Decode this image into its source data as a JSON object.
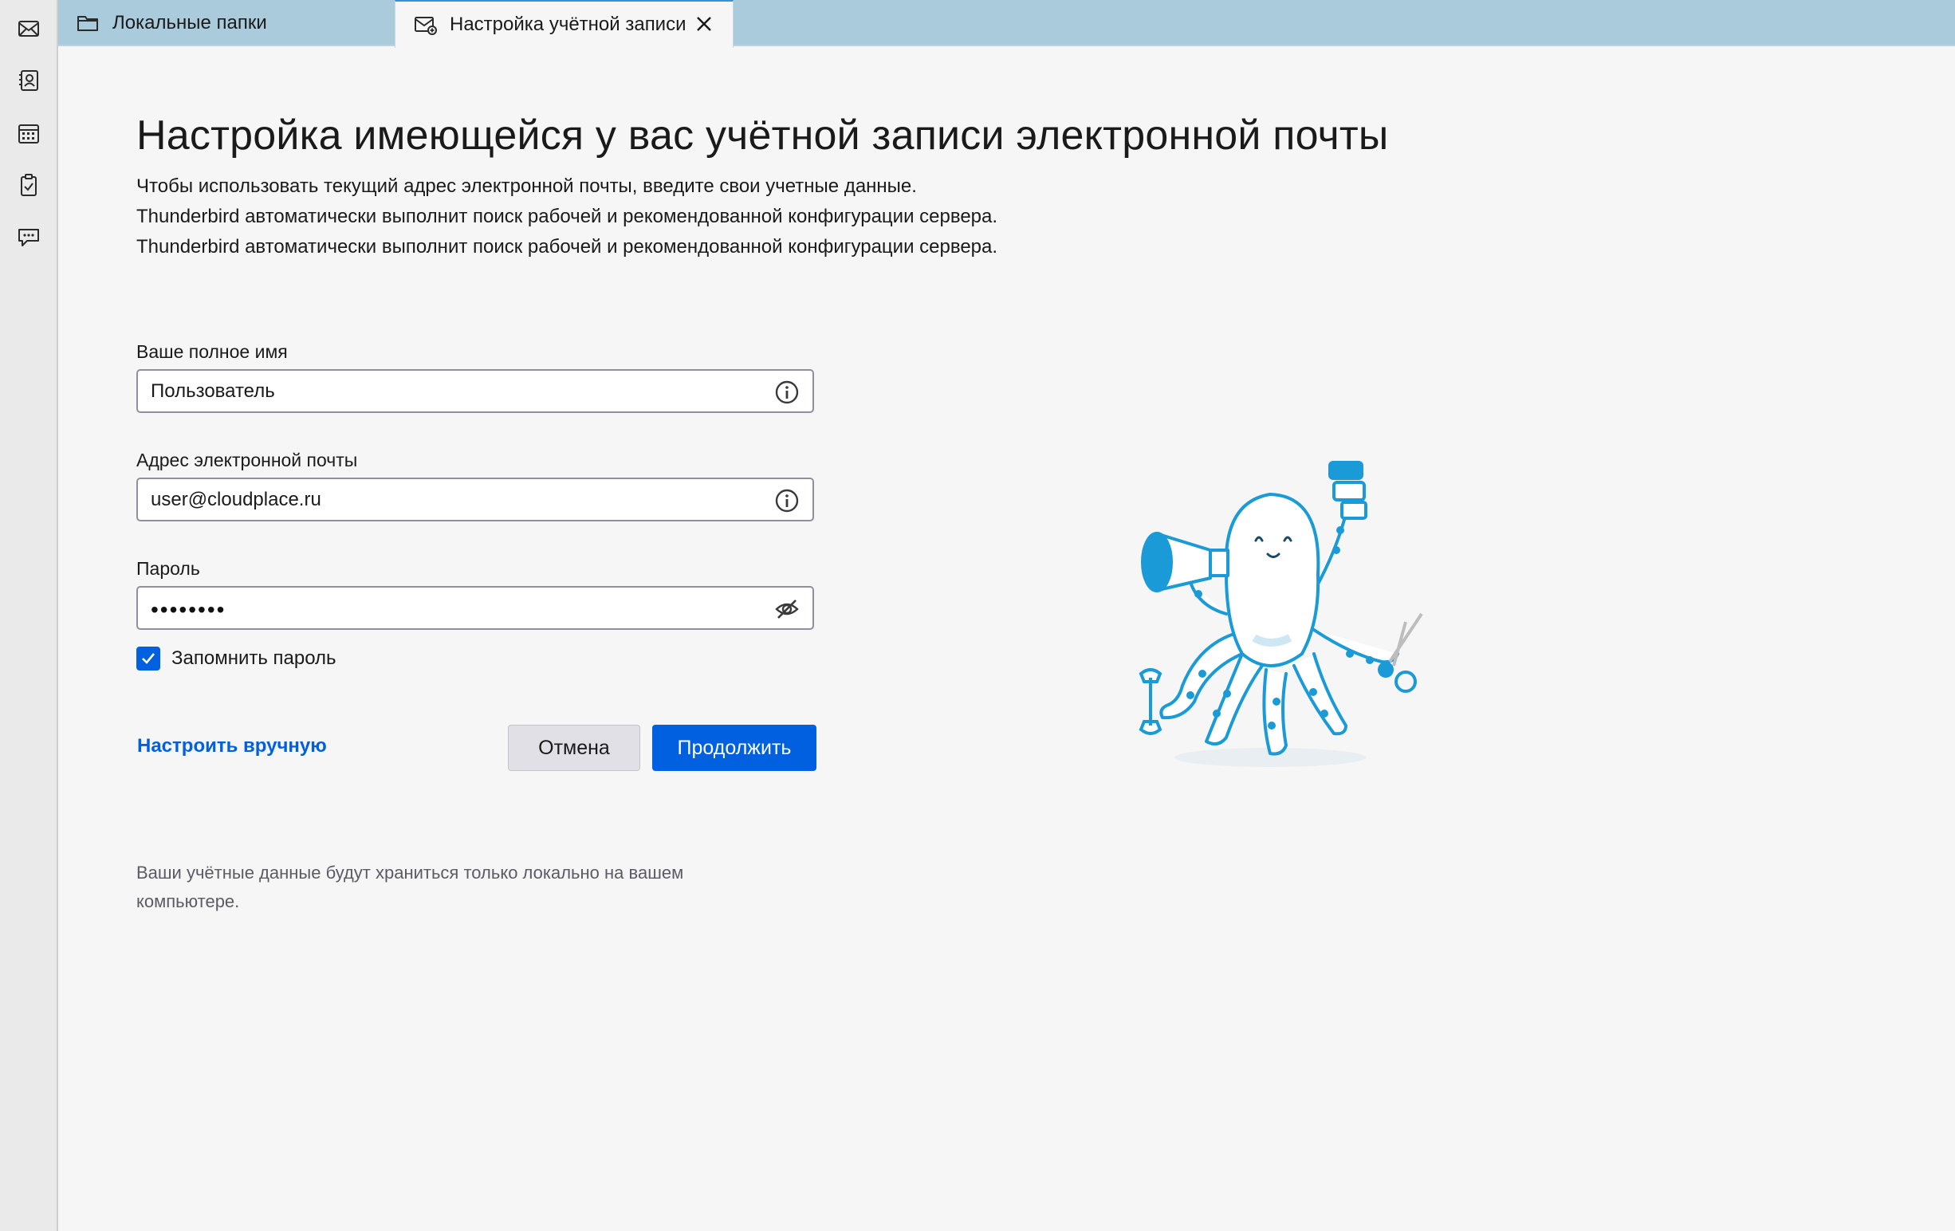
{
  "spaces": [
    {
      "name": "mail",
      "icon": "envelope-icon"
    },
    {
      "name": "address-book",
      "icon": "contacts-icon"
    },
    {
      "name": "calendar",
      "icon": "calendar-icon"
    },
    {
      "name": "tasks",
      "icon": "tasks-icon"
    },
    {
      "name": "chat",
      "icon": "chat-icon"
    }
  ],
  "tabs": [
    {
      "label": "Локальные папки",
      "icon": "folder-icon",
      "active": false
    },
    {
      "label": "Настройка учётной записи",
      "icon": "account-setup-icon",
      "active": true
    }
  ],
  "page": {
    "title": "Настройка имеющейся у вас учётной записи электронной почты",
    "desc_lines": [
      "Чтобы использовать текущий адрес электронной почты, введите свои учетные данные.",
      "Thunderbird автоматически выполнит поиск рабочей и рекомендованной конфигурации сервера.",
      "Thunderbird автоматически выполнит поиск рабочей и рекомендованной конфигурации сервера."
    ]
  },
  "form": {
    "name_label": "Ваше полное имя",
    "name_value": "Пользователь",
    "email_label": "Адрес электронной почты",
    "email_value": "user@cloudplace.ru",
    "password_label": "Пароль",
    "password_mask": "••••••••",
    "remember_label": "Запомнить пароль",
    "remember_checked": true
  },
  "actions": {
    "manual_link": "Настроить вручную",
    "cancel": "Отмена",
    "continue": "Продолжить"
  },
  "footnote": {
    "line1": "Ваши учётные данные будут храниться только локально на вашем",
    "line2": "компьютере."
  },
  "colors": {
    "accent": "#0060df",
    "tabbar": "#a9cbdb",
    "mascot": "#1a9ad6"
  }
}
